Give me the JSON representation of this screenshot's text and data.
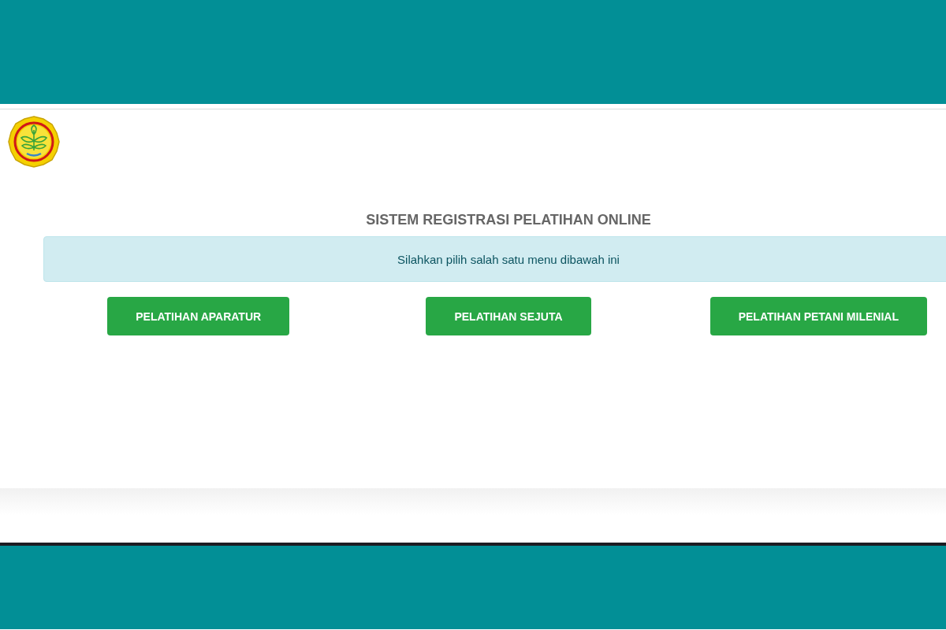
{
  "header": {
    "title": "SISTEM REGISTRASI PELATIHAN ONLINE"
  },
  "alert": {
    "message": "Silahkan pilih salah satu menu dibawah ini"
  },
  "menu_buttons": [
    {
      "label": "PELATIHAN APARATUR"
    },
    {
      "label": "PELATIHAN SEJUTA"
    },
    {
      "label": "PELATIHAN PETANI MILENIAL"
    }
  ]
}
